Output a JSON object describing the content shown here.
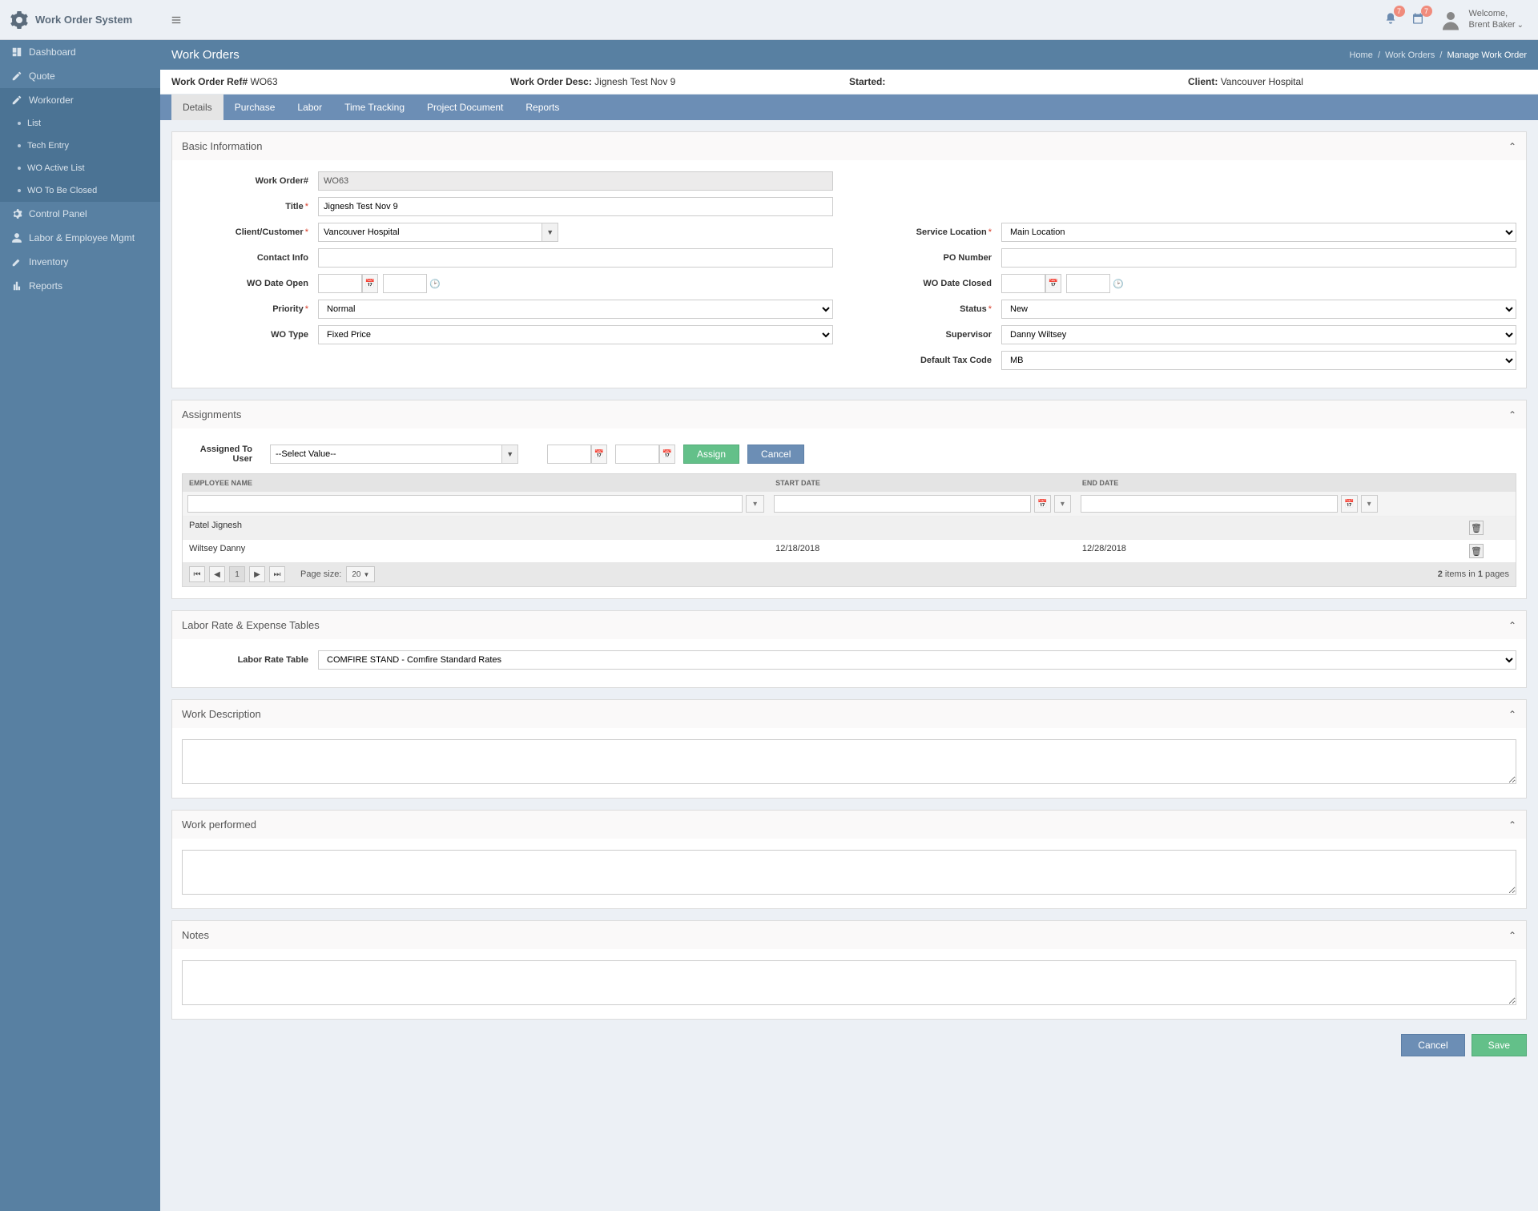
{
  "app": {
    "title": "Work Order System"
  },
  "header": {
    "bell_badge": "7",
    "cal_badge": "7",
    "welcome_label": "Welcome,",
    "user_name": "Brent Baker"
  },
  "sidebar": {
    "items": [
      {
        "label": "Dashboard"
      },
      {
        "label": "Quote"
      },
      {
        "label": "Workorder"
      },
      {
        "label": "Control Panel"
      },
      {
        "label": "Labor & Employee Mgmt"
      },
      {
        "label": "Inventory"
      },
      {
        "label": "Reports"
      }
    ],
    "workorder_sub": [
      {
        "label": "List"
      },
      {
        "label": "Tech Entry"
      },
      {
        "label": "WO Active List"
      },
      {
        "label": "WO To Be Closed"
      }
    ]
  },
  "page": {
    "title": "Work Orders",
    "breadcrumb": {
      "home": "Home",
      "mid": "Work Orders",
      "active": "Manage Work Order"
    }
  },
  "summary": {
    "ref_label": "Work Order Ref#",
    "ref_value": "WO63",
    "desc_label": "Work Order Desc:",
    "desc_value": "Jignesh Test Nov 9",
    "started_label": "Started:",
    "started_value": "",
    "client_label": "Client:",
    "client_value": "Vancouver Hospital"
  },
  "tabs": [
    {
      "label": "Details"
    },
    {
      "label": "Purchase"
    },
    {
      "label": "Labor"
    },
    {
      "label": "Time Tracking"
    },
    {
      "label": "Project Document"
    },
    {
      "label": "Reports"
    }
  ],
  "basic": {
    "title": "Basic Information",
    "labels": {
      "work_order_no": "Work Order#",
      "title_lbl": "Title",
      "client": "Client/Customer",
      "contact": "Contact Info",
      "wo_open": "WO Date Open",
      "priority": "Priority",
      "wo_type": "WO Type",
      "service_loc": "Service Location",
      "po_number": "PO Number",
      "wo_closed": "WO Date Closed",
      "status": "Status",
      "supervisor": "Supervisor",
      "tax_code": "Default Tax Code"
    },
    "values": {
      "work_order_no": "WO63",
      "title_val": "Jignesh Test Nov 9",
      "client": "Vancouver Hospital",
      "priority": "Normal",
      "wo_type": "Fixed Price",
      "service_loc": "Main Location",
      "status": "New",
      "supervisor": "Danny Wiltsey",
      "tax_code": "MB"
    }
  },
  "assignments": {
    "title": "Assignments",
    "assigned_label": "Assigned To User",
    "select_placeholder": "--Select Value--",
    "assign_btn": "Assign",
    "cancel_btn": "Cancel",
    "cols": {
      "emp": "EMPLOYEE NAME",
      "start": "START DATE",
      "end": "END DATE"
    },
    "rows": [
      {
        "emp": "Patel Jignesh",
        "start": "",
        "end": ""
      },
      {
        "emp": "Wiltsey Danny",
        "start": "12/18/2018",
        "end": "12/28/2018"
      }
    ],
    "pager": {
      "page_size_label": "Page size:",
      "page_size": "20",
      "items_total": "2",
      "pages_total": "1",
      "status_tpl_1": " items in ",
      "status_tpl_2": " pages"
    }
  },
  "labor_rate": {
    "title": "Labor Rate & Expense Tables",
    "label": "Labor Rate Table",
    "value": "COMFIRE STAND - Comfire Standard Rates"
  },
  "desc_panel": {
    "title": "Work Description"
  },
  "perf_panel": {
    "title": "Work performed"
  },
  "notes_panel": {
    "title": "Notes"
  },
  "footer": {
    "cancel": "Cancel",
    "save": "Save"
  }
}
